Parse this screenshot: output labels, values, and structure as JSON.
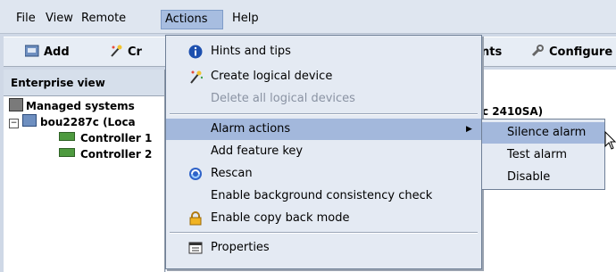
{
  "menubar": {
    "items": [
      {
        "label": "File"
      },
      {
        "label": "View"
      },
      {
        "label": "Remote"
      },
      {
        "label": "Actions"
      },
      {
        "label": "Help"
      }
    ]
  },
  "toolbar": {
    "add_label": "Add",
    "create_label_partial": "Cr",
    "events_label_partial": "nts",
    "configure_label": "Configure"
  },
  "enterprise_view": {
    "header": "Enterprise view",
    "tree": {
      "managed_systems": "Managed systems",
      "device": "bou2287c (Loca",
      "controller1": "Controller 1",
      "controller2": "Controller 2"
    }
  },
  "right_panel": {
    "label_partial": "c 2410SA)"
  },
  "actions_menu": {
    "items": [
      {
        "label": "Hints and tips"
      },
      {
        "label": "Create logical device"
      },
      {
        "label": "Delete all logical devices"
      },
      {
        "label": "Alarm actions"
      },
      {
        "label": "Add feature key"
      },
      {
        "label": "Rescan"
      },
      {
        "label": "Enable background consistency check"
      },
      {
        "label": "Enable copy back mode"
      },
      {
        "label": "Properties"
      }
    ]
  },
  "alarm_submenu": {
    "items": [
      {
        "label": "Silence alarm"
      },
      {
        "label": "Test alarm"
      },
      {
        "label": "Disable"
      }
    ]
  },
  "colors": {
    "highlight": "#a3b8dc",
    "menu_bg": "#e4eaf3",
    "disabled_text": "#8a93a3"
  }
}
